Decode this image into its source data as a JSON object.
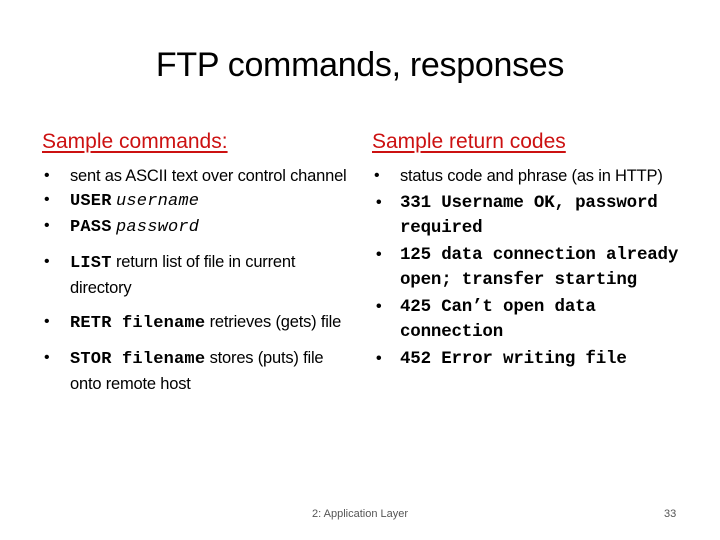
{
  "slide": {
    "title": "FTP commands, responses",
    "left": {
      "heading": "Sample commands:",
      "items": [
        {
          "text": "sent as ASCII text over control channel"
        },
        {
          "cmd": "USER",
          "arg": "username"
        },
        {
          "cmd": "PASS",
          "arg": "password"
        },
        {
          "cmd": "LIST",
          "rest": " return list of file in current directory"
        },
        {
          "cmd": "RETR filename",
          "rest": " retrieves (gets) file"
        },
        {
          "cmd": "STOR filename",
          "rest": " stores (puts) file onto remote host"
        }
      ]
    },
    "right": {
      "heading": "Sample return codes",
      "items": [
        "status code and phrase (as in HTTP)",
        "331 Username OK, password required",
        "125 data connection already open; transfer starting",
        "425 Can’t open data connection",
        "452 Error writing file"
      ]
    },
    "footer": {
      "center": "2: Application Layer",
      "page_number": "33"
    },
    "colors": {
      "heading": "#cc1111",
      "text": "#000000",
      "footer": "#555555"
    }
  }
}
